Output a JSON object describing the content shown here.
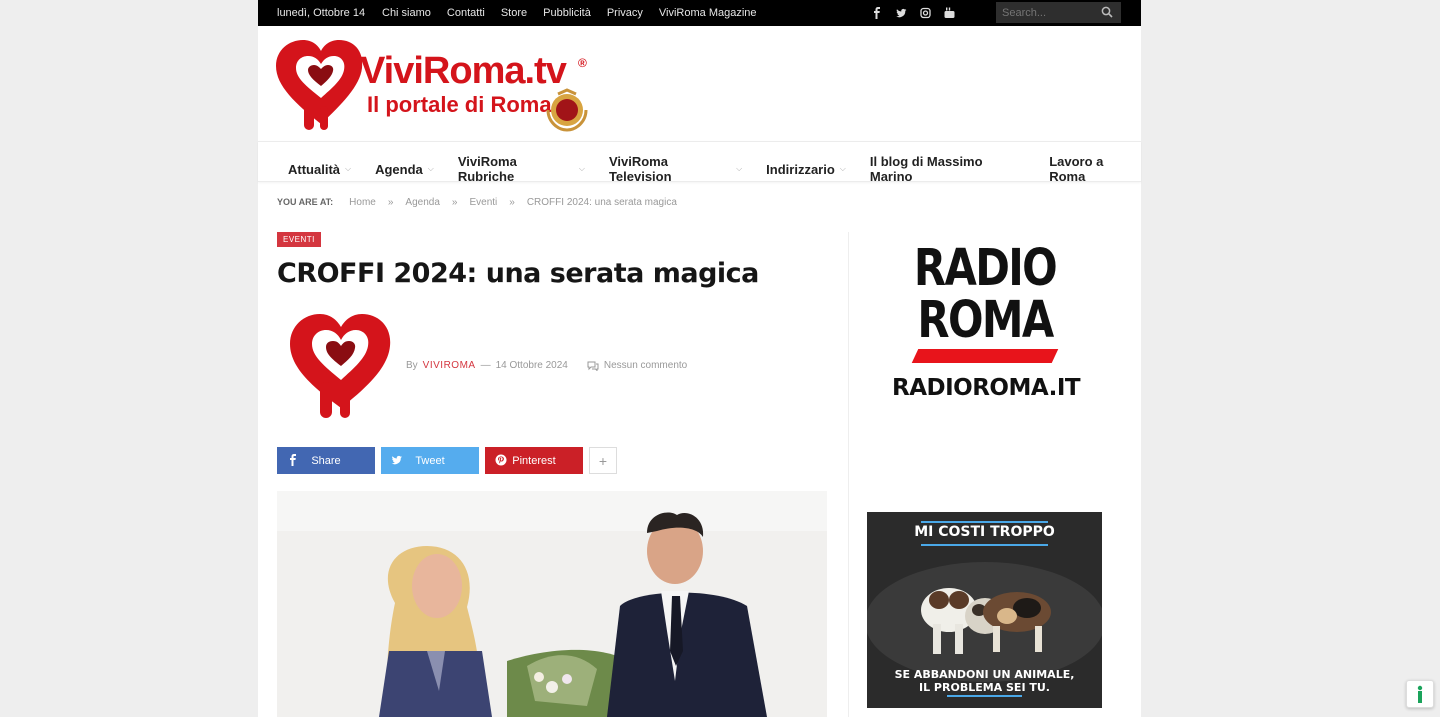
{
  "topbar": {
    "date": "lunedì, Ottobre 14",
    "links": [
      "Chi siamo",
      "Contatti",
      "Store",
      "Pubblicità",
      "Privacy",
      "ViviRoma Magazine"
    ],
    "social_icons": [
      "facebook-icon",
      "twitter-icon",
      "instagram-icon",
      "youtube-icon"
    ],
    "search_placeholder": "Search..."
  },
  "logo": {
    "line1": "ViviRoma.tv",
    "line2": "Il portale di Roma",
    "registered": "®"
  },
  "nav": {
    "items": [
      {
        "label": "Attualità",
        "has_dropdown": true
      },
      {
        "label": "Agenda",
        "has_dropdown": true
      },
      {
        "label": "ViviRoma Rubriche",
        "has_dropdown": true
      },
      {
        "label": "ViviRoma Television",
        "has_dropdown": true
      },
      {
        "label": "Indirizzario",
        "has_dropdown": true
      },
      {
        "label": "Il blog di Massimo Marino",
        "has_dropdown": false
      },
      {
        "label": "Lavoro a Roma",
        "has_dropdown": false
      }
    ]
  },
  "breadcrumb": {
    "label": "YOU ARE AT:",
    "separator": "»",
    "items": [
      "Home",
      "Agenda",
      "Eventi",
      "CROFFI 2024: una serata magica"
    ]
  },
  "article": {
    "category": "EVENTI",
    "title": "CROFFI 2024: una serata magica",
    "by": "By",
    "author": "VIVIROMA",
    "dash": "—",
    "date": "14 Ottobre 2024",
    "comments": "Nessun commento"
  },
  "share": {
    "facebook": "Share",
    "twitter": "Tweet",
    "pinterest": "Pinterest",
    "more": "+"
  },
  "sidebar": {
    "radio": {
      "line1": "RADIO",
      "line2": "ROMA",
      "url": "RADIOROMA.IT"
    },
    "ad": {
      "top": "MI COSTI TROPPO",
      "bottom_line1": "SE ABBANDONI UN ANIMALE,",
      "bottom_line2": "IL PROBLEMA SEI TU."
    }
  },
  "colors": {
    "brand_red": "#d4141b",
    "accent": "#d4363f",
    "facebook": "#4267b2",
    "twitter": "#55acee",
    "pinterest": "#cb2027"
  }
}
